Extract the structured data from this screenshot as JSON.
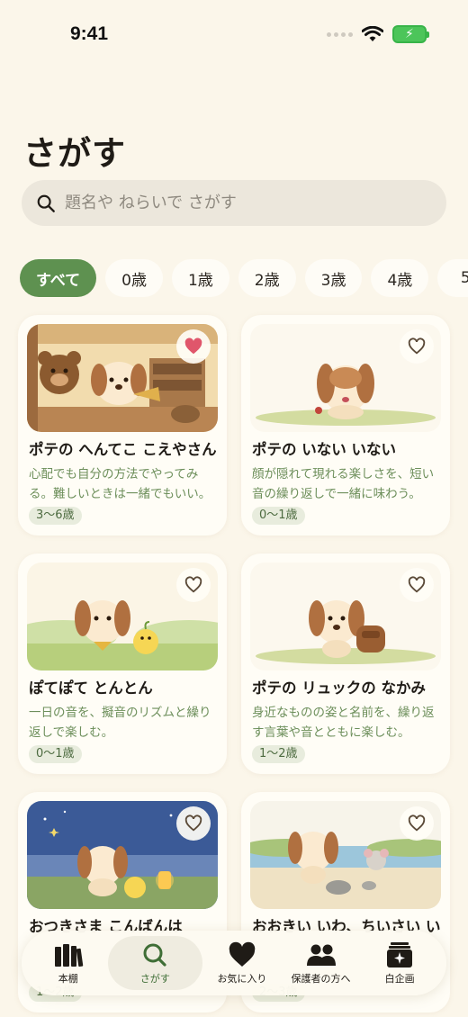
{
  "status": {
    "time": "9:41"
  },
  "page": {
    "title": "さがす"
  },
  "search": {
    "placeholder": "題名や ねらいで さがす"
  },
  "age_filters": [
    {
      "label": "すべて",
      "active": true
    },
    {
      "label": "0歳",
      "active": false
    },
    {
      "label": "1歳",
      "active": false
    },
    {
      "label": "2歳",
      "active": false
    },
    {
      "label": "3歳",
      "active": false
    },
    {
      "label": "4歳",
      "active": false
    },
    {
      "label": "5",
      "active": false
    }
  ],
  "books": [
    {
      "title": "ポテの へんてこ こえやさん",
      "description": "心配でも自分の方法でやってみる。難しいときは一緒でもいい。",
      "age": "3〜6歳",
      "favorite": true
    },
    {
      "title": "ポテの いない いない",
      "description": "顔が隠れて現れる楽しさを、短い音の繰り返しで一緒に味わう。",
      "age": "0〜1歳",
      "favorite": false
    },
    {
      "title": "ぽてぽて とんとん",
      "description": "一日の音を、擬音のリズムと繰り返しで楽しむ。",
      "age": "0〜1歳",
      "favorite": false
    },
    {
      "title": "ポテの リュックの なかみ",
      "description": "身近なものの姿と名前を、繰り返す言葉や音とともに楽しむ。",
      "age": "1〜2歳",
      "favorite": false
    },
    {
      "title": "おつきさま こんばんは",
      "description": "",
      "age": "1〜2歳",
      "favorite": false
    },
    {
      "title": "おおきい いわ、ちいさい い",
      "description": "",
      "age": "2〜3歳",
      "favorite": false
    }
  ],
  "tabs": [
    {
      "label": "本棚",
      "icon": "bookshelf-icon",
      "active": false
    },
    {
      "label": "さがす",
      "icon": "search-icon",
      "active": true
    },
    {
      "label": "お気に入り",
      "icon": "heart-icon",
      "active": false
    },
    {
      "label": "保護者の方へ",
      "icon": "parents-icon",
      "active": false
    },
    {
      "label": "白企画",
      "icon": "sparkle-book-icon",
      "active": false
    }
  ],
  "colors": {
    "accent": "#5e9150",
    "background": "#fbf6ea",
    "favorite": "#e0566b",
    "desc_text": "#6d8f5b"
  }
}
